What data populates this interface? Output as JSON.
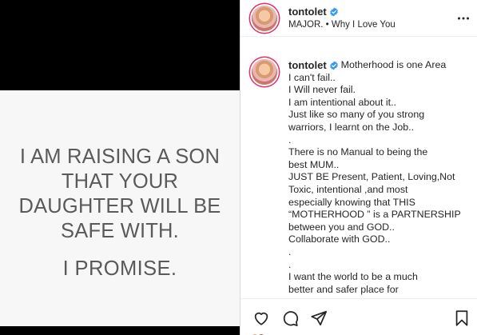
{
  "image": {
    "quote_text": "I AM RAISING A SON\nTHAT YOUR\nDAUGHTER WILL BE\nSAFE WITH.",
    "promise_text": "I PROMISE."
  },
  "header": {
    "username": "tontolet",
    "subtitle": "MAJOR. • Why I Love You",
    "more_icon": "more-horizontal-icon"
  },
  "caption": {
    "username": "tontolet",
    "first_line": "Motherhood is one Area",
    "lines": [
      "I can't fail..",
      "I Will never fail.",
      "I am intentional about it..",
      "Just like so many of you strong",
      "warriors, I learnt on the Job..",
      ".",
      "There is no Manual to being the",
      "best MUM..",
      "JUST BE Present, Patient, Loving,Not",
      "Toxic, intentional ,and most",
      "especially knowing that THIS",
      "“MOTHERHOOD ” is a PARTNERSHIP",
      "between you and GOD..",
      "Collaborate with GOD..",
      ".",
      ".",
      "I want the world to be a much",
      "better and safer place for"
    ]
  },
  "actions": {
    "like_icon": "heart-icon",
    "comment_icon": "comment-icon",
    "share_icon": "paper-plane-icon",
    "save_icon": "bookmark-icon"
  },
  "colors": {
    "verified": "#3897f0",
    "story_ring": "#e1306c",
    "quote_text": "#5a5a5a"
  }
}
